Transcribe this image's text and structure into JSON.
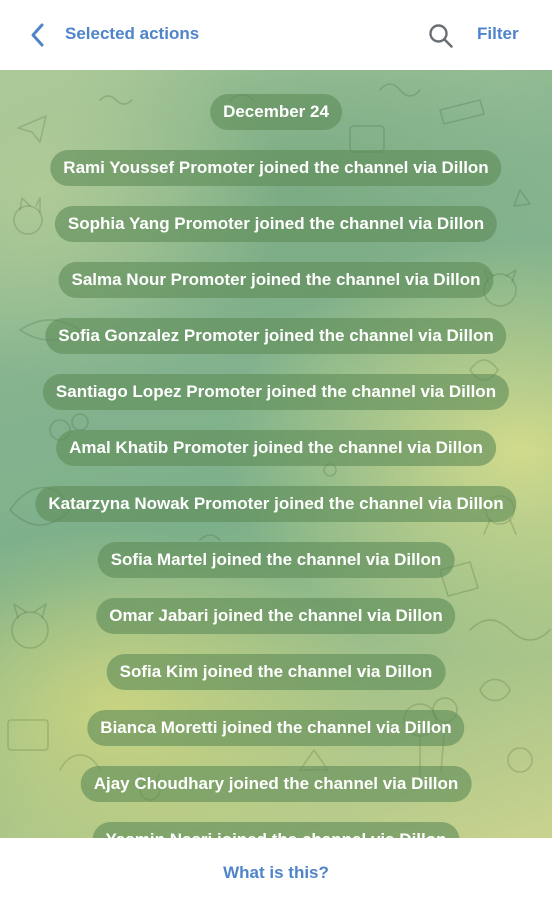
{
  "header": {
    "back_icon": "chevron-left-icon",
    "title": "Selected actions",
    "search_icon": "search-icon",
    "filter_label": "Filter"
  },
  "chat": {
    "date": "December 24",
    "messages": [
      "Rami Youssef Promoter joined the channel via Dillon",
      "Sophia Yang Promoter joined the channel via Dillon",
      "Salma Nour Promoter joined the channel via Dillon",
      "Sofia Gonzalez Promoter joined the channel via Dillon",
      "Santiago Lopez Promoter joined the channel via Dillon",
      "Amal Khatib Promoter joined the channel via Dillon",
      "Katarzyna Nowak Promoter joined the channel via Dillon",
      "Sofia Martel joined the channel via Dillon",
      "Omar Jabari joined the channel via Dillon",
      "Sofia Kim joined the channel via Dillon",
      "Bianca Moretti joined the channel via Dillon",
      "Ajay Choudhary joined the channel via Dillon",
      "Yasmin Nasri joined the channel via Dillon"
    ]
  },
  "footer": {
    "help_label": "What is this?"
  },
  "colors": {
    "accent": "#4f84c9",
    "pill_background": "#608c58"
  }
}
